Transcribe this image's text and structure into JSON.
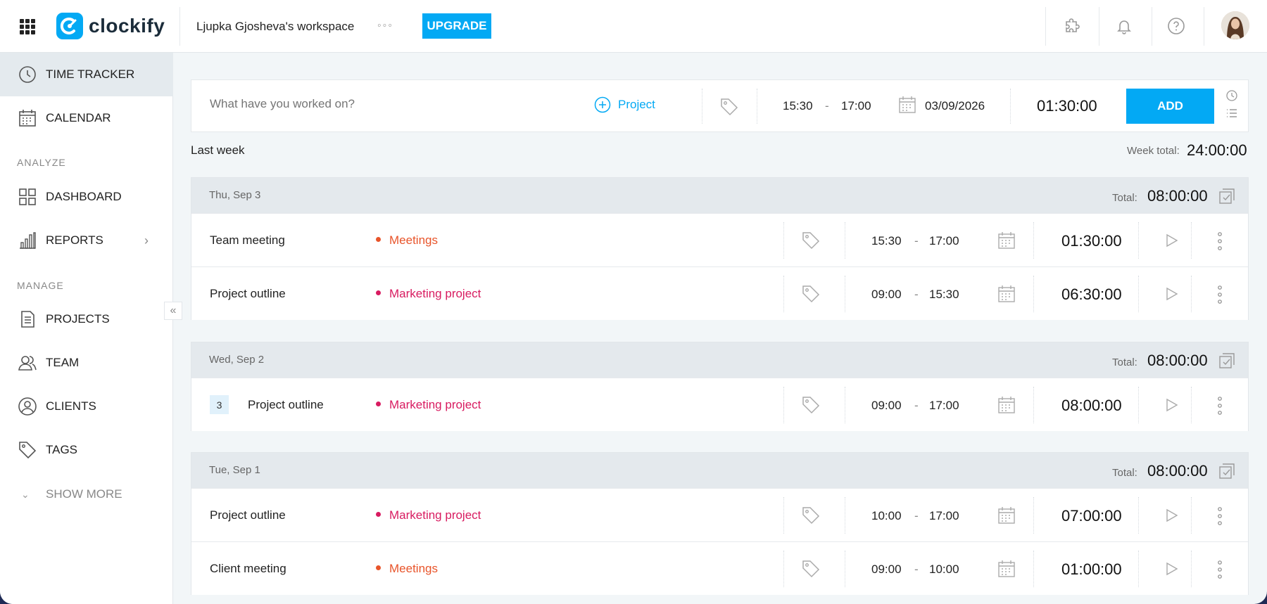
{
  "topbar": {
    "logo_text": "clockify",
    "workspace": "Ljupka Gjosheva's workspace",
    "more_dots": "◦◦◦",
    "upgrade_label": "UPGRADE"
  },
  "sidebar": {
    "items": [
      {
        "label": "TIME TRACKER",
        "icon": "clock-icon"
      },
      {
        "label": "CALENDAR",
        "icon": "calendar-icon"
      },
      {
        "label": "DASHBOARD",
        "icon": "dashboard-icon"
      },
      {
        "label": "REPORTS",
        "icon": "bar-chart-icon"
      },
      {
        "label": "PROJECTS",
        "icon": "document-icon"
      },
      {
        "label": "TEAM",
        "icon": "team-icon"
      },
      {
        "label": "CLIENTS",
        "icon": "user-circle-icon"
      },
      {
        "label": "TAGS",
        "icon": "tag-icon"
      }
    ],
    "section_analyze": "ANALYZE",
    "section_manage": "MANAGE",
    "show_more": "SHOW MORE",
    "collapse_glyph": "«"
  },
  "entry": {
    "placeholder": "What have you worked on?",
    "project_label": "Project",
    "start": "15:30",
    "dash": "-",
    "end": "17:00",
    "date": "03/09/2026",
    "duration": "01:30:00",
    "add_label": "ADD"
  },
  "week": {
    "label": "Last week",
    "total_label": "Week total:",
    "total": "24:00:00"
  },
  "colors": {
    "accent": "#03a9f4",
    "meetings": "#e8542a",
    "marketing": "#d81b60"
  },
  "days": [
    {
      "date": "Thu, Sep 3",
      "total_label": "Total:",
      "total": "08:00:00",
      "entries": [
        {
          "desc": "Team meeting",
          "project": "Meetings",
          "color": "#e8542a",
          "start": "15:30",
          "end": "17:00",
          "duration": "01:30:00"
        },
        {
          "desc": "Project outline",
          "project": "Marketing project",
          "color": "#d81b60",
          "start": "09:00",
          "end": "15:30",
          "duration": "06:30:00"
        }
      ]
    },
    {
      "date": "Wed, Sep 2",
      "total_label": "Total:",
      "total": "08:00:00",
      "entries": [
        {
          "count": "3",
          "desc": "Project outline",
          "project": "Marketing project",
          "color": "#d81b60",
          "start": "09:00",
          "end": "17:00",
          "duration": "08:00:00"
        }
      ]
    },
    {
      "date": "Tue, Sep 1",
      "total_label": "Total:",
      "total": "08:00:00",
      "entries": [
        {
          "desc": "Project outline",
          "project": "Marketing project",
          "color": "#d81b60",
          "start": "10:00",
          "end": "17:00",
          "duration": "07:00:00"
        },
        {
          "desc": "Client meeting",
          "project": "Meetings",
          "color": "#e8542a",
          "start": "09:00",
          "end": "10:00",
          "duration": "01:00:00"
        }
      ]
    }
  ]
}
